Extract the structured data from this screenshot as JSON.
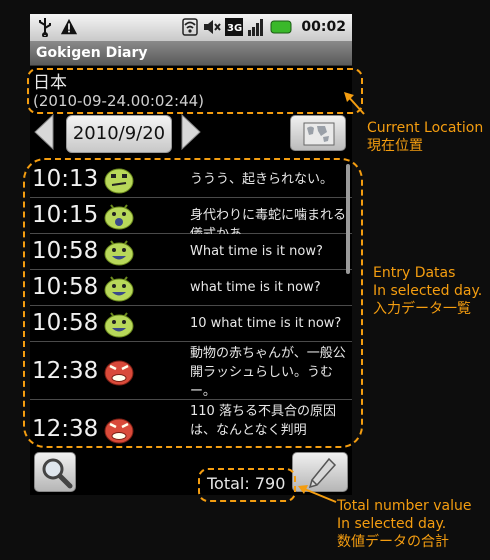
{
  "status_bar": {
    "time": "00:02",
    "icons": [
      "usb-icon",
      "warning-icon",
      "wifi-icon",
      "mute-icon",
      "3g-icon",
      "signal-icon",
      "battery-icon"
    ]
  },
  "app": {
    "title": "Gokigen Diary"
  },
  "location": {
    "name": "日本",
    "timestamp": "(2010-09-24.00:02:44)"
  },
  "date_nav": {
    "date": "2010/9/20"
  },
  "entries": [
    {
      "time": "10:13",
      "mood": "unhappy",
      "text": "ううう、起きられない。"
    },
    {
      "time": "10:15",
      "mood": "shocked",
      "text": "身代わりに毒蛇に噛まれる儀式かあ。"
    },
    {
      "time": "10:58",
      "mood": "happy",
      "text": "What time is it now?"
    },
    {
      "time": "10:58",
      "mood": "happy",
      "text": "what time is it now?"
    },
    {
      "time": "10:58",
      "mood": "happy",
      "text": "10  what time is it now?"
    },
    {
      "time": "12:38",
      "mood": "angry",
      "text": "動物の赤ちゃんが、一般公開ラッシュらしい。うむー。"
    },
    {
      "time": "12:38",
      "mood": "angry",
      "text": "110 落ちる不具合の原因は、なんとなく判明"
    }
  ],
  "footer": {
    "total_label": "Total: 790"
  },
  "annotations": {
    "location": [
      "Current Location",
      "現在位置"
    ],
    "entries": [
      "Entry Datas",
      "In selected day.",
      "入力データ一覧"
    ],
    "total": [
      "Total  number value",
      "In selected day.",
      "数値データの合計"
    ]
  },
  "colors": {
    "accent": "#f49d10",
    "happy": "#b8d85a",
    "angry": "#d94a3a"
  }
}
